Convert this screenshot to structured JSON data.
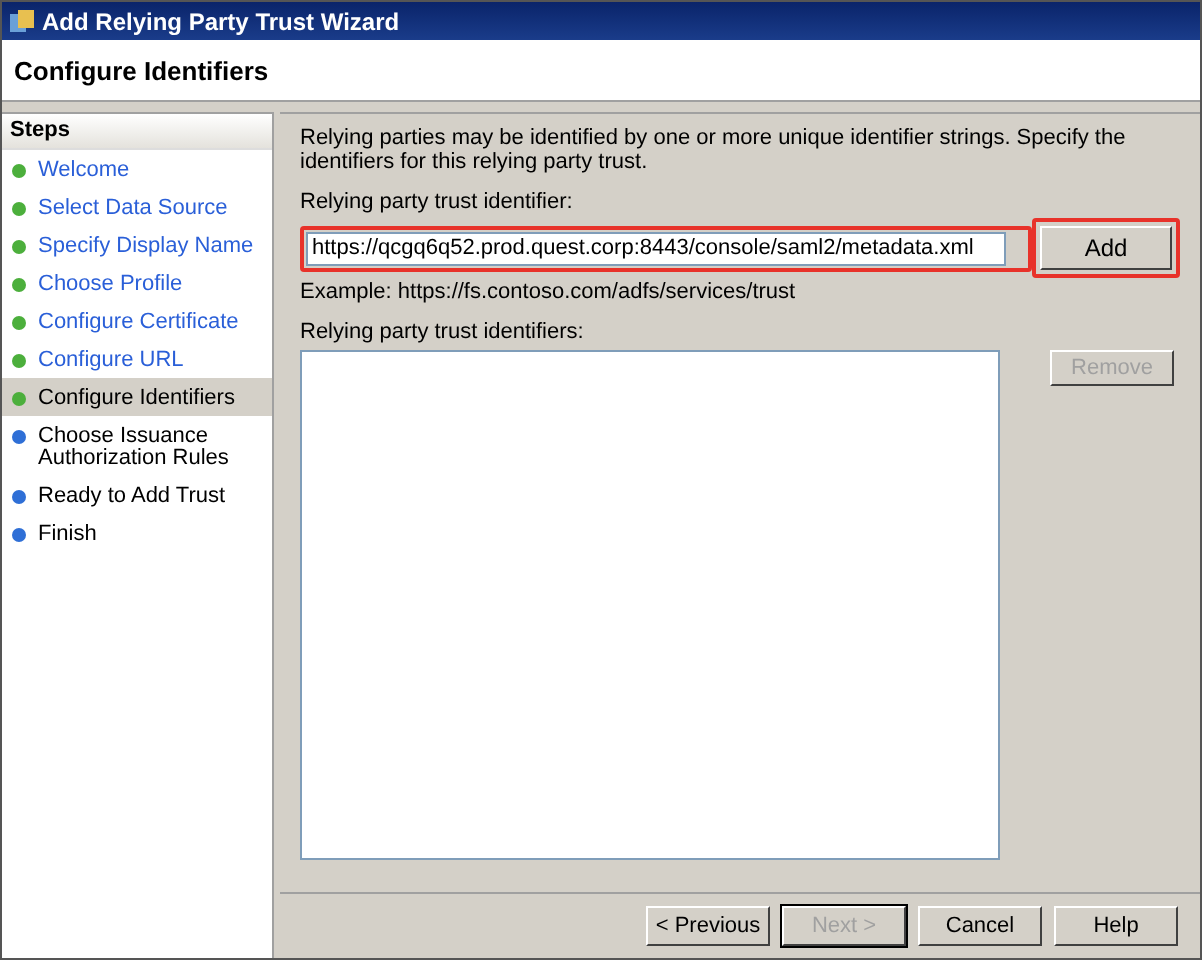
{
  "window": {
    "title": "Add Relying Party Trust Wizard"
  },
  "header": {
    "title": "Configure Identifiers"
  },
  "steps": {
    "title": "Steps",
    "items": [
      {
        "label": "Welcome",
        "completed": true,
        "selected": false,
        "color": "#4caf3c"
      },
      {
        "label": "Select Data Source",
        "completed": true,
        "selected": false,
        "color": "#4caf3c"
      },
      {
        "label": "Specify Display Name",
        "completed": true,
        "selected": false,
        "color": "#4caf3c"
      },
      {
        "label": "Choose Profile",
        "completed": true,
        "selected": false,
        "color": "#4caf3c"
      },
      {
        "label": "Configure Certificate",
        "completed": true,
        "selected": false,
        "color": "#4caf3c"
      },
      {
        "label": "Configure URL",
        "completed": true,
        "selected": false,
        "color": "#4caf3c"
      },
      {
        "label": "Configure Identifiers",
        "completed": false,
        "selected": true,
        "color": "#4caf3c"
      },
      {
        "label": "Choose Issuance Authorization Rules",
        "completed": false,
        "selected": false,
        "color": "#2f6fd6"
      },
      {
        "label": "Ready to Add Trust",
        "completed": false,
        "selected": false,
        "color": "#2f6fd6"
      },
      {
        "label": "Finish",
        "completed": false,
        "selected": false,
        "color": "#2f6fd6"
      }
    ]
  },
  "content": {
    "description": "Relying parties may be identified by one or more unique identifier strings. Specify the identifiers for this relying party trust.",
    "identifier_label": "Relying party trust identifier:",
    "identifier_value": "https://qcgq6q52.prod.quest.corp:8443/console/saml2/metadata.xml",
    "identifier_highlighted": true,
    "add_button": {
      "label": "Add",
      "highlighted": true,
      "disabled": false
    },
    "example": "Example: https://fs.contoso.com/adfs/services/trust",
    "list_label": "Relying party trust identifiers:",
    "remove_button": {
      "label": "Remove",
      "disabled": true
    }
  },
  "buttons": [
    {
      "label": "< Previous",
      "disabled": false
    },
    {
      "label": "Next >",
      "disabled": true
    },
    {
      "label": "Cancel",
      "disabled": false
    },
    {
      "label": "Help",
      "disabled": false
    }
  ]
}
